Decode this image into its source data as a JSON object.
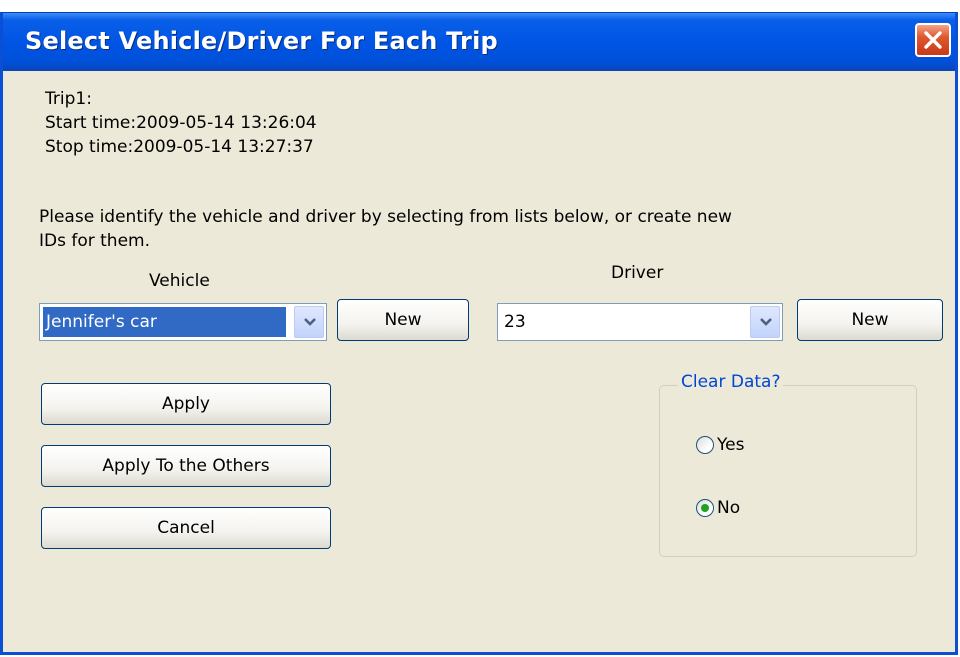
{
  "window": {
    "title": "Select Vehicle/Driver For Each Trip",
    "close_glyph": "close-icon"
  },
  "trip": {
    "name": "Trip1:",
    "start": "Start time:2009-05-14 13:26:04",
    "stop": "Stop time:2009-05-14 13:27:37"
  },
  "prompt": "Please identify the vehicle and driver by selecting from lists below, or create new IDs for them.",
  "vehicle": {
    "label": "Vehicle",
    "value": "Jennifer's car",
    "new_label": "New"
  },
  "driver": {
    "label": "Driver",
    "value": "23",
    "new_label": "New"
  },
  "actions": {
    "apply": "Apply",
    "apply_others": "Apply To the Others",
    "cancel": "Cancel"
  },
  "clear_data": {
    "legend": "Clear Data?",
    "yes": "Yes",
    "no": "No",
    "selected": "No"
  },
  "colors": {
    "titlebar": "#0055e5",
    "selection": "#316ac5",
    "group_legend": "#0046d5",
    "face": "#ece9d8"
  }
}
